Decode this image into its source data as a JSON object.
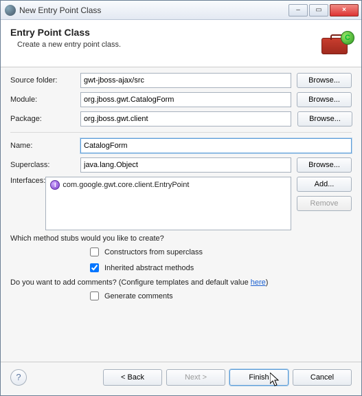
{
  "titlebar": {
    "title": "New Entry Point Class",
    "min_label": "–",
    "max_label": "▭",
    "close_label": "×"
  },
  "banner": {
    "title": "Entry Point Class",
    "description": "Create a new entry point class.",
    "badge_letter": "C"
  },
  "form": {
    "source_folder": {
      "label": "Source folder:",
      "value": "gwt-jboss-ajax/src",
      "browse": "Browse..."
    },
    "module": {
      "label": "Module:",
      "value": "org.jboss.gwt.CatalogForm",
      "browse": "Browse..."
    },
    "package": {
      "label": "Package:",
      "value": "org.jboss.gwt.client",
      "browse": "Browse..."
    },
    "name": {
      "label": "Name:",
      "value": "CatalogForm"
    },
    "superclass": {
      "label": "Superclass:",
      "value": "java.lang.Object",
      "browse": "Browse..."
    },
    "interfaces": {
      "label": "Interfaces:",
      "items": [
        "com.google.gwt.core.client.EntryPoint"
      ],
      "add": "Add...",
      "remove": "Remove"
    }
  },
  "stubs": {
    "question": "Which method stubs would you like to create?",
    "constructors": {
      "label": "Constructors from superclass",
      "checked": false
    },
    "inherited": {
      "label": "Inherited abstract methods",
      "checked": true
    }
  },
  "comments": {
    "question_pre": "Do you want to add comments? (Configure templates and default value ",
    "here": "here",
    "question_post": ")",
    "generate": {
      "label": "Generate comments",
      "checked": false
    }
  },
  "footer": {
    "help": "?",
    "back": "< Back",
    "next": "Next >",
    "finish": "Finish",
    "cancel": "Cancel"
  }
}
